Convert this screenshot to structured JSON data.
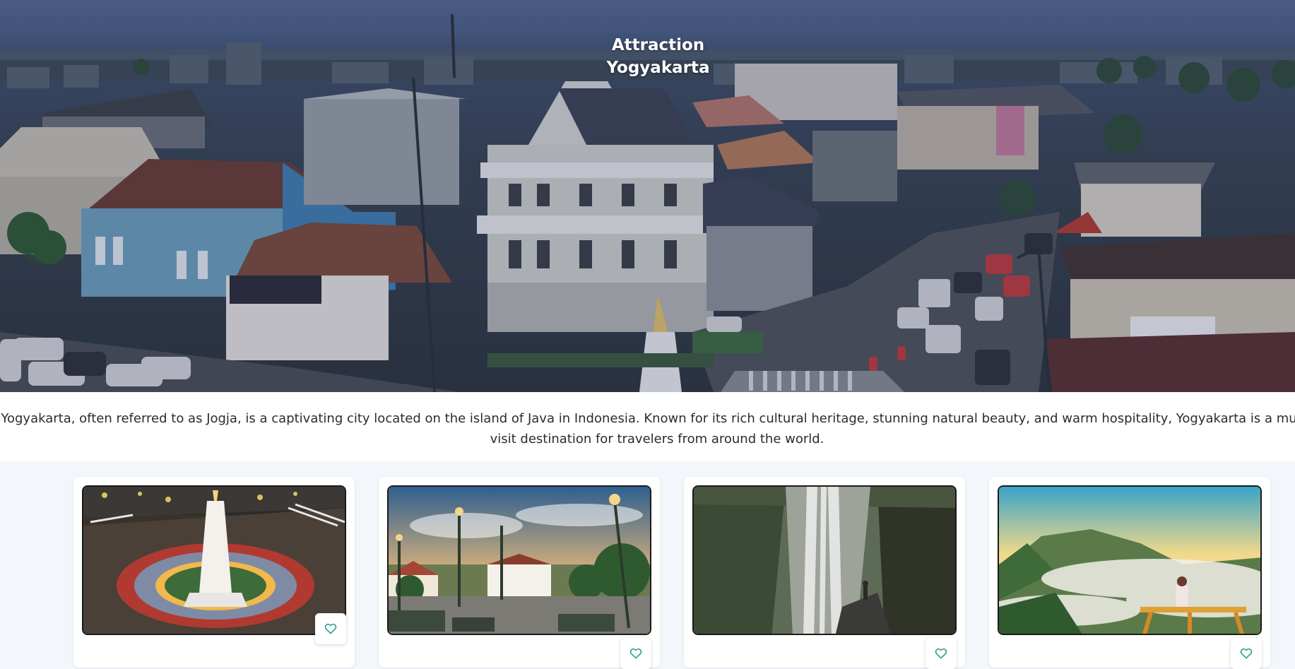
{
  "hero": {
    "title_line1": "Attraction",
    "title_line2": "Yogyakarta"
  },
  "intro": {
    "text": "Yogyakarta, often referred to as Jogja, is a captivating city located on the island of Java in Indonesia. Known for its rich cultural heritage, stunning natural beauty, and warm hospitality, Yogyakarta is a must-visit destination for travelers from around the world."
  },
  "cards": [
    {
      "image": "tugu-monument-night-photo",
      "favorite_icon": "heart-icon"
    },
    {
      "image": "town-square-street-lamps-photo",
      "favorite_icon": "heart-icon"
    },
    {
      "image": "cave-waterfall-light-photo",
      "favorite_icon": "heart-icon"
    },
    {
      "image": "misty-hills-viewpoint-photo",
      "favorite_icon": "heart-icon"
    }
  ],
  "colors": {
    "accent": "#2a9d8f",
    "card_background": "#ffffff",
    "page_background": "#f3f7fb"
  }
}
